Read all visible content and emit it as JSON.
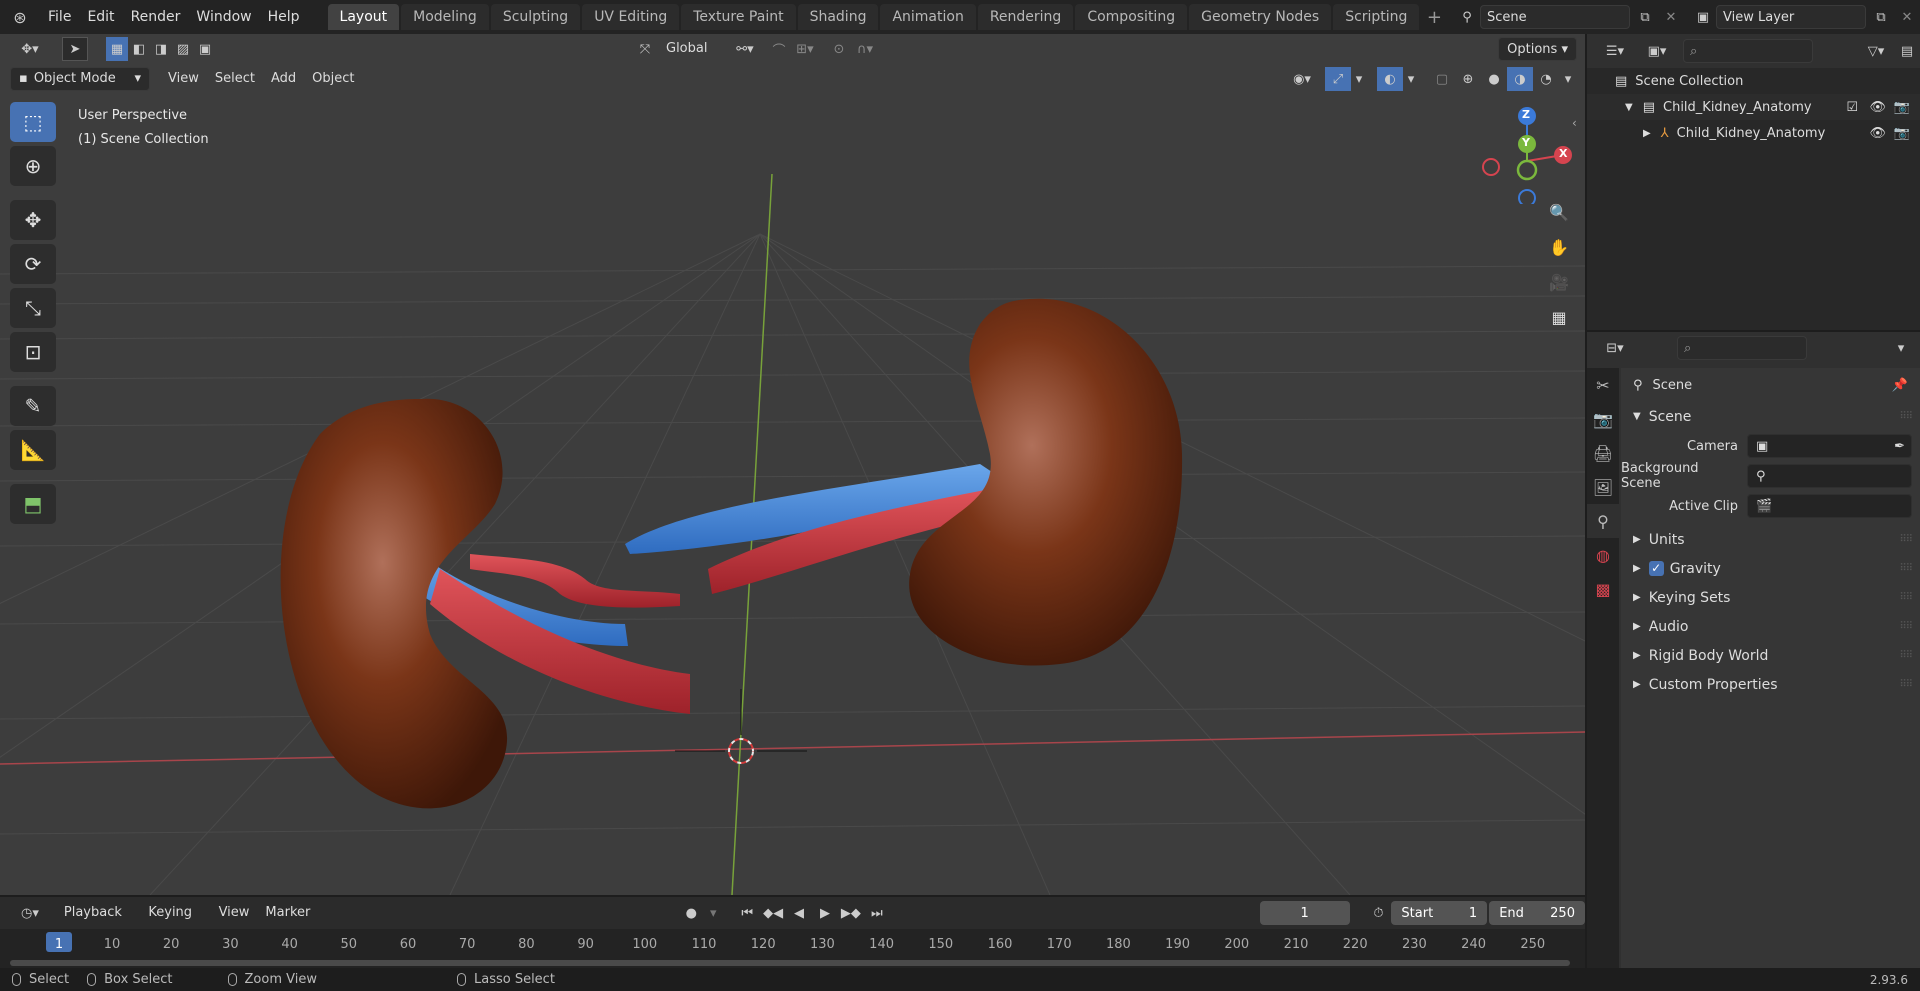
{
  "topbar": {
    "menu": [
      "File",
      "Edit",
      "Render",
      "Window",
      "Help"
    ],
    "workspaces": [
      "Layout",
      "Modeling",
      "Sculpting",
      "UV Editing",
      "Texture Paint",
      "Shading",
      "Animation",
      "Rendering",
      "Compositing",
      "Geometry Nodes",
      "Scripting"
    ],
    "active_workspace": "Layout",
    "add_tab": "+",
    "scene": "Scene",
    "view_layer": "View Layer"
  },
  "viewport": {
    "transform_orientation": "Global",
    "options_label": "Options",
    "mode": "Object Mode",
    "menus": [
      "View",
      "Select",
      "Add",
      "Object"
    ],
    "perspective_label": "User Perspective",
    "collection_label": "(1) Scene Collection",
    "gizmo": {
      "z": "Z",
      "y": "Y",
      "x": "X"
    },
    "colors": {
      "x_axis": "#d5444f",
      "y_axis": "#7bb83d",
      "z_axis": "#3b7ad9",
      "background": "#3d3d3d",
      "kidney": "#7a3518",
      "vein": "#4a8ad6",
      "artery": "#c8363b"
    }
  },
  "outliner": {
    "root": "Scene Collection",
    "items": [
      {
        "label": "Child_Kidney_Anatomy",
        "kind": "collection"
      },
      {
        "label": "Child_Kidney_Anatomy",
        "kind": "object"
      }
    ]
  },
  "properties": {
    "context_title": "Scene",
    "section_title": "Scene",
    "fields": [
      {
        "label": "Camera",
        "value": ""
      },
      {
        "label": "Background Scene",
        "value": ""
      },
      {
        "label": "Active Clip",
        "value": ""
      }
    ],
    "panels": [
      "Units",
      "Gravity",
      "Keying Sets",
      "Audio",
      "Rigid Body World",
      "Custom Properties"
    ],
    "gravity_checked": true
  },
  "timeline": {
    "menus": [
      "Playback",
      "Keying",
      "View",
      "Marker"
    ],
    "current_frame": "1",
    "start_label": "Start",
    "start_value": "1",
    "end_label": "End",
    "end_value": "250",
    "ticks": [
      "1",
      "10",
      "20",
      "30",
      "40",
      "50",
      "60",
      "70",
      "80",
      "90",
      "100",
      "110",
      "120",
      "130",
      "140",
      "150",
      "160",
      "170",
      "180",
      "190",
      "200",
      "210",
      "220",
      "230",
      "240",
      "250"
    ]
  },
  "statusbar": {
    "select": "Select",
    "box_select": "Box Select",
    "zoom_view": "Zoom View",
    "lasso_select": "Lasso Select",
    "version": "2.93.6"
  }
}
